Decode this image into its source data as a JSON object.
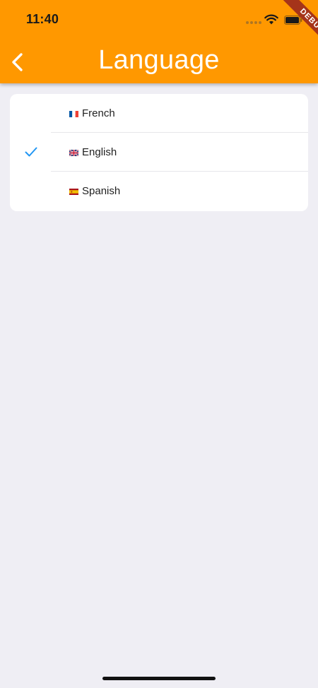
{
  "status_bar": {
    "time": "11:40"
  },
  "debug_banner": {
    "text": "DEBUG",
    "color": "#A5341A"
  },
  "header": {
    "title": "Language",
    "back_icon": "chevron-left-icon",
    "background": "#FF9800"
  },
  "languages": [
    {
      "label": "French",
      "flag_icon": "france-flag-icon",
      "selected": false
    },
    {
      "label": "English",
      "flag_icon": "uk-flag-icon",
      "selected": true
    },
    {
      "label": "Spanish",
      "flag_icon": "spain-flag-icon",
      "selected": false
    }
  ],
  "colors": {
    "accent": "#2196F3",
    "background": "#EFEEF4"
  }
}
